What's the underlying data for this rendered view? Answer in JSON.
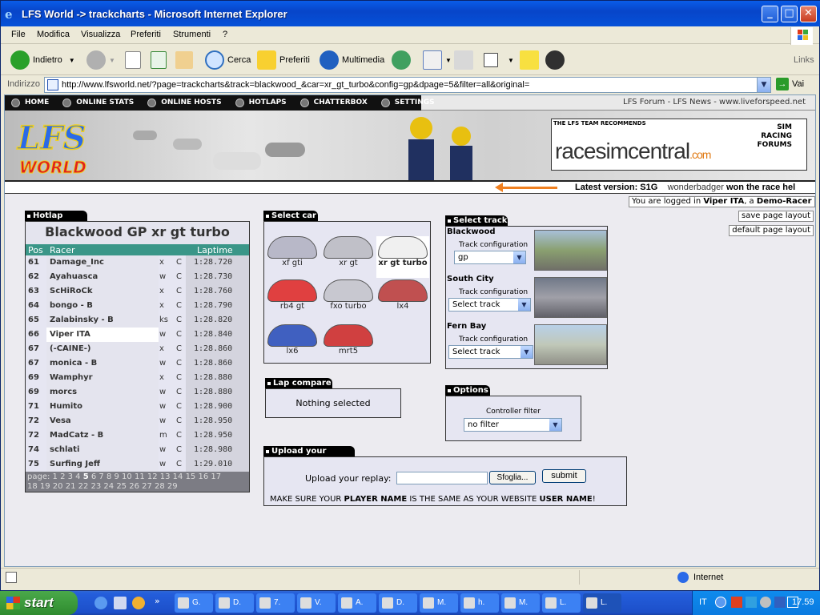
{
  "window": {
    "title": "LFS World -> trackcharts - Microsoft Internet Explorer"
  },
  "menu": [
    "File",
    "Modifica",
    "Visualizza",
    "Preferiti",
    "Strumenti",
    "?"
  ],
  "toolbar": {
    "back": "Indietro",
    "search": "Cerca",
    "favorites": "Preferiti",
    "multimedia": "Multimedia",
    "links": "Links"
  },
  "address": {
    "label": "Indirizzo",
    "url": "http://www.lfsworld.net/?page=trackcharts&track=blackwood_&car=xr_gt_turbo&config=gp&dpage=5&filter=all&original=",
    "go": "Vai"
  },
  "sitenav": [
    "HOME",
    "ONLINE STATS",
    "ONLINE HOSTS",
    "HOTLAPS",
    "CHATTERBOX",
    "SETTINGS"
  ],
  "forum_links": "LFS Forum - LFS News - www.liveforspeed.net",
  "banner": {
    "logo_top": "LFS",
    "logo_bottom": "WORLD",
    "ad_recommends": "THE LFS TEAM RECOMMENDS",
    "ad_name": "racesimcentral",
    "ad_tld": ".com",
    "ad_side": "SIM RACING FORUMS"
  },
  "ticker": {
    "version_label": "Latest version: S1G",
    "news_user": "wonderbadger",
    "news_text": "won the race hel"
  },
  "login": {
    "prefix": "You are logged in",
    "user": "Viper ITA",
    "mid": ", a",
    "role": "Demo-Racer"
  },
  "layout_buttons": {
    "save": "save page layout",
    "default": "default page layout"
  },
  "hotlap": {
    "header": "Hotlap chart",
    "title": "Blackwood GP xr gt turbo",
    "col_pos": "Pos",
    "col_racer": "Racer",
    "col_laptime": "Laptime",
    "rows": [
      {
        "pos": "61",
        "name": "Damage_Inc",
        "t": "x",
        "c": "C",
        "lap": "1:28.720"
      },
      {
        "pos": "62",
        "name": "Ayahuasca",
        "t": "w",
        "c": "C",
        "lap": "1:28.730"
      },
      {
        "pos": "63",
        "name": "ScHiRoCk",
        "t": "x",
        "c": "C",
        "lap": "1:28.760"
      },
      {
        "pos": "64",
        "name": "bongo - B",
        "t": "x",
        "c": "C",
        "lap": "1:28.790"
      },
      {
        "pos": "65",
        "name": "Zalabinsky - B",
        "t": "ks",
        "c": "C",
        "lap": "1:28.820"
      },
      {
        "pos": "66",
        "name": "Viper ITA",
        "t": "w",
        "c": "C",
        "lap": "1:28.840"
      },
      {
        "pos": "67",
        "name": "(-CAINE-)",
        "t": "x",
        "c": "C",
        "lap": "1:28.860"
      },
      {
        "pos": "67",
        "name": "monica - B",
        "t": "w",
        "c": "C",
        "lap": "1:28.860"
      },
      {
        "pos": "69",
        "name": "Wamphyr",
        "t": "x",
        "c": "C",
        "lap": "1:28.880"
      },
      {
        "pos": "69",
        "name": "morcs",
        "t": "w",
        "c": "C",
        "lap": "1:28.880"
      },
      {
        "pos": "71",
        "name": "Humito",
        "t": "w",
        "c": "C",
        "lap": "1:28.900"
      },
      {
        "pos": "72",
        "name": "Vesa",
        "t": "w",
        "c": "C",
        "lap": "1:28.950"
      },
      {
        "pos": "72",
        "name": "MadCatz - B",
        "t": "m",
        "c": "C",
        "lap": "1:28.950"
      },
      {
        "pos": "74",
        "name": "schlati",
        "t": "w",
        "c": "C",
        "lap": "1:28.980"
      },
      {
        "pos": "75",
        "name": "Surfing Jeff",
        "t": "w",
        "c": "C",
        "lap": "1:29.010"
      }
    ],
    "pages_label": "page:",
    "pages_line1": "1 2 3 4",
    "current_page": "5",
    "pages_line1_rest": "6 7 8 9 10 11 12 13 14 15 16 17",
    "pages_line2": "18 19 20 21 22 23 24 25 26 27 28 29"
  },
  "select_car": {
    "header": "Select car",
    "cars": [
      "xf gti",
      "xr gt",
      "xr gt turbo",
      "rb4 gt",
      "fxo turbo",
      "lx4",
      "lx6",
      "mrt5"
    ],
    "selected": "xr gt turbo",
    "car_colors": [
      "#b8b8c8",
      "#c0c0c8",
      "#f0f0f0",
      "#e04040",
      "#c8c8d0",
      "#c05050",
      "#4060c0",
      "#d04040"
    ]
  },
  "select_track": {
    "header": "Select track",
    "config_label": "Track configuration",
    "tracks": [
      {
        "name": "Blackwood",
        "value": "gp"
      },
      {
        "name": "South City",
        "value": "Select track"
      },
      {
        "name": "Fern Bay",
        "value": "Select track"
      }
    ]
  },
  "lap_compare": {
    "header": "Lap compare",
    "text": "Nothing selected"
  },
  "options": {
    "header": "Options",
    "filter_label": "Controller filter",
    "filter_value": "no filter"
  },
  "upload": {
    "header": "Upload your hotlap",
    "label": "Upload your replay:",
    "browse": "Sfoglia...",
    "submit": "submit",
    "note_1": "MAKE SURE YOUR",
    "note_player": "PLAYER NAME",
    "note_2": "IS THE SAME AS YOUR WEBSITE",
    "note_user": "USER NAME",
    "note_3": "!"
  },
  "status": {
    "zone": "Internet"
  },
  "taskbar": {
    "start": "start",
    "items": [
      "G.",
      "D.",
      "7.",
      "V.",
      "A.",
      "D.",
      "M.",
      "h.",
      "M.",
      "L.",
      "L."
    ],
    "lang": "IT",
    "clock": "17.59"
  }
}
